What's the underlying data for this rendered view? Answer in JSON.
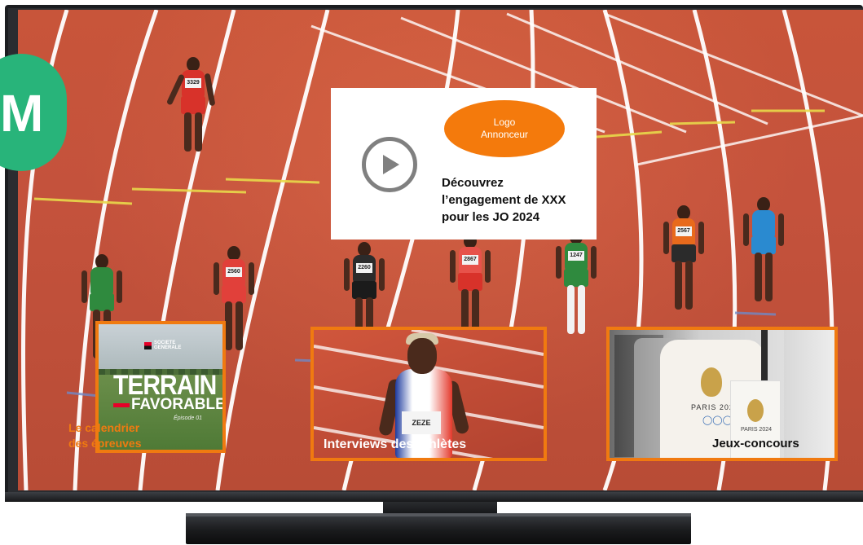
{
  "badge": {
    "letter": "M"
  },
  "ad": {
    "logo_text": "Logo\nAnnonceur",
    "headline": "Découvrez\nl’engagement de XXX\npour les JO 2024",
    "play_icon": "play-icon"
  },
  "tiles": [
    {
      "label": "Le calendrier\ndes épreuves",
      "thumb_brand": "SOCIETE\nGENERALE",
      "thumb_title_1": "TERRAIN",
      "thumb_title_2": "FAVORABLE",
      "thumb_episode": "Épisode 01"
    },
    {
      "label": "Interviews des athlètes",
      "bib": "ZEZE"
    },
    {
      "label": "Jeux-concours",
      "shirt_text": "PARIS 2024",
      "bag_text": "PARIS 2024"
    }
  ],
  "athlete_bibs": [
    "3329",
    "2560",
    "2260",
    "2867",
    "1247",
    "2567"
  ],
  "colors": {
    "accent_orange": "#f07a10",
    "logo_orange": "#f47a0c",
    "badge_green": "#28b47a",
    "track_red": "#c4523c"
  }
}
